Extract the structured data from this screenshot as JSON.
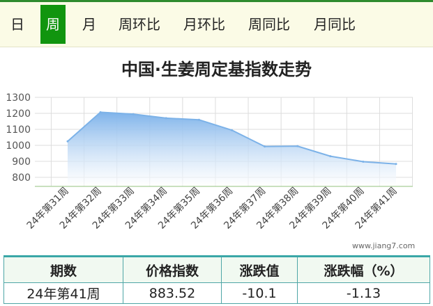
{
  "tabs": [
    {
      "label": "日",
      "active": false
    },
    {
      "label": "周",
      "active": true
    },
    {
      "label": "月",
      "active": false
    },
    {
      "label": "周环比",
      "active": false
    },
    {
      "label": "月环比",
      "active": false
    },
    {
      "label": "周同比",
      "active": false
    },
    {
      "label": "月同比",
      "active": false
    }
  ],
  "watermark": "www.jiang7.com",
  "chart_data": {
    "type": "area",
    "title": "中国·生姜周定基指数走势",
    "xlabel": "",
    "ylabel": "",
    "categories": [
      "24年第31周",
      "24年第32周",
      "24年第33周",
      "24年第34周",
      "24年第35周",
      "24年第36周",
      "24年第37周",
      "24年第38周",
      "24年第39周",
      "24年第40周",
      "24年第41周"
    ],
    "values": [
      1025,
      1207,
      1195,
      1170,
      1160,
      1095,
      993,
      995,
      932,
      898,
      883.52
    ],
    "ylim": [
      800,
      1300
    ],
    "yticks": [
      800,
      900,
      1000,
      1100,
      1200,
      1300
    ],
    "grid": true,
    "colors": {
      "line": "#7cb2e8",
      "fill_top": "#7fb3ea",
      "fill_bottom": "#ffffff"
    }
  },
  "table": {
    "headers": [
      "期数",
      "价格指数",
      "涨跌值",
      "涨跌幅（%）"
    ],
    "rows": [
      [
        "24年第41周",
        "883.52",
        "-10.1",
        "-1.13"
      ]
    ]
  }
}
